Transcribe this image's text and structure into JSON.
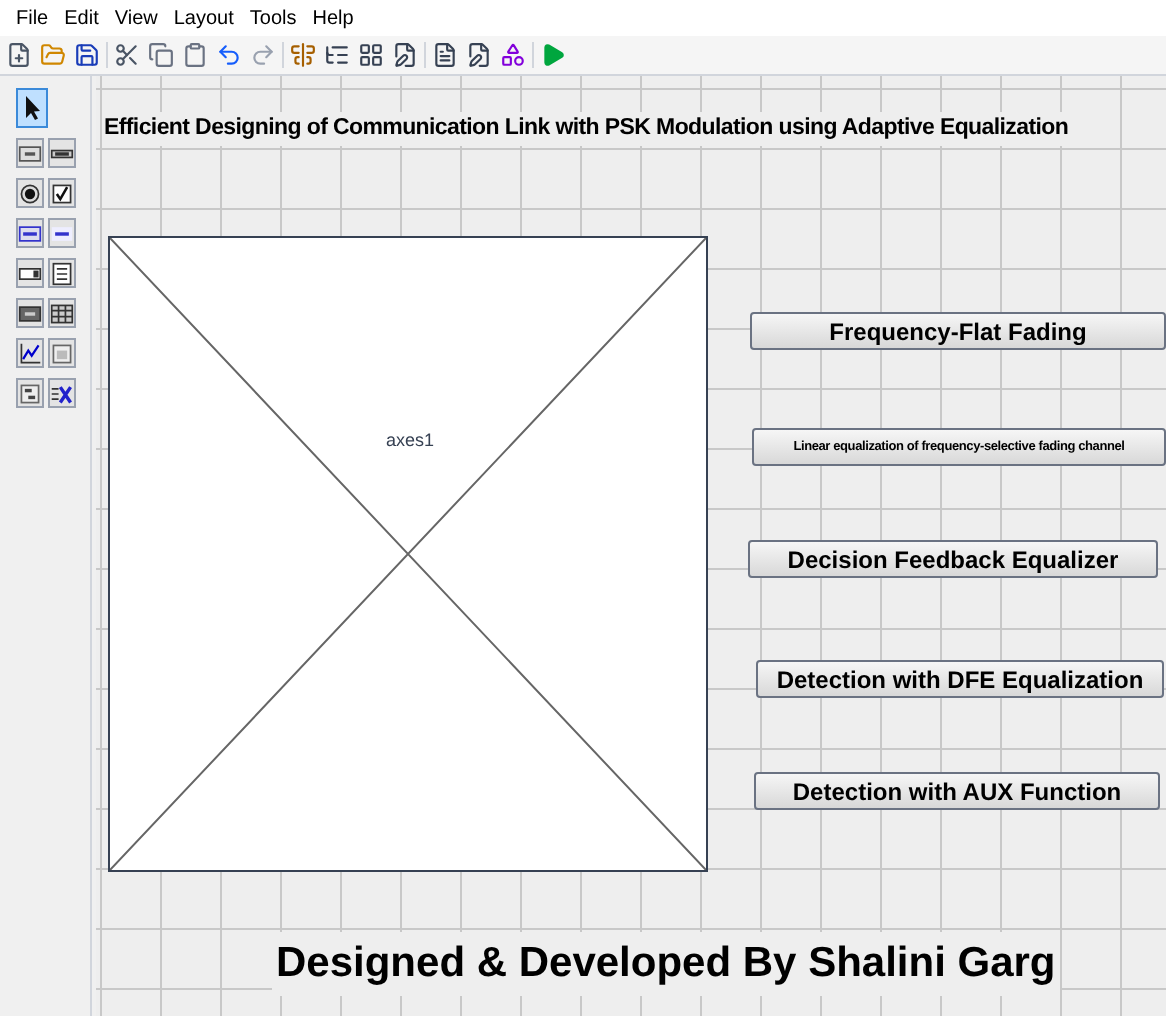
{
  "menu": [
    "File",
    "Edit",
    "View",
    "Layout",
    "Tools",
    "Help"
  ],
  "palette": [
    {
      "kind": "pointer",
      "selected": true
    },
    {
      "kind": "pushbutton",
      "selected": false
    },
    {
      "kind": "slider",
      "selected": false
    },
    {
      "kind": "radio",
      "selected": false
    },
    {
      "kind": "checkbox",
      "selected": false
    },
    {
      "kind": "edit",
      "selected": false
    },
    {
      "kind": "text",
      "selected": false
    },
    {
      "kind": "popup",
      "selected": false
    },
    {
      "kind": "listbox",
      "selected": false
    },
    {
      "kind": "toggle",
      "selected": false
    },
    {
      "kind": "table",
      "selected": false
    },
    {
      "kind": "axes",
      "selected": false
    },
    {
      "kind": "panel",
      "selected": false
    },
    {
      "kind": "buttongroup",
      "selected": false
    },
    {
      "kind": "activex",
      "selected": false
    }
  ],
  "canvas": {
    "title": "Efficient Designing of Communication Link with PSK Modulation using Adaptive Equalization",
    "axes_label": "axes1",
    "buttons": [
      "Frequency-Flat Fading",
      "Linear equalization of frequency-selective fading channel",
      "Decision Feedback Equalizer",
      "Detection with DFE Equalization",
      "Detection with AUX Function"
    ],
    "footer": "Designed & Developed By Shalini Garg"
  }
}
